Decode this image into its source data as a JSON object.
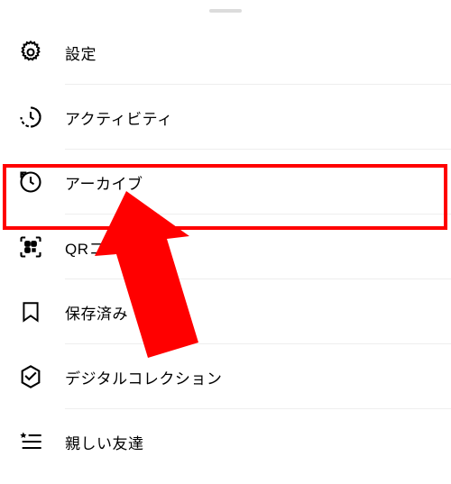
{
  "menu": [
    {
      "id": "settings",
      "label": "設定",
      "icon": "settings"
    },
    {
      "id": "activity",
      "label": "アクティビティ",
      "icon": "activity"
    },
    {
      "id": "archive",
      "label": "アーカイブ",
      "icon": "archive",
      "highlighted": true
    },
    {
      "id": "qr",
      "label": "QRコード",
      "icon": "qr"
    },
    {
      "id": "saved",
      "label": "保存済み",
      "icon": "saved"
    },
    {
      "id": "digital-collection",
      "label": "デジタルコレクション",
      "icon": "digital-collection"
    },
    {
      "id": "close-friends",
      "label": "親しい友達",
      "icon": "close-friends"
    }
  ],
  "annotation": {
    "highlight_color": "#ff0000",
    "arrow_color": "#ff0000"
  }
}
